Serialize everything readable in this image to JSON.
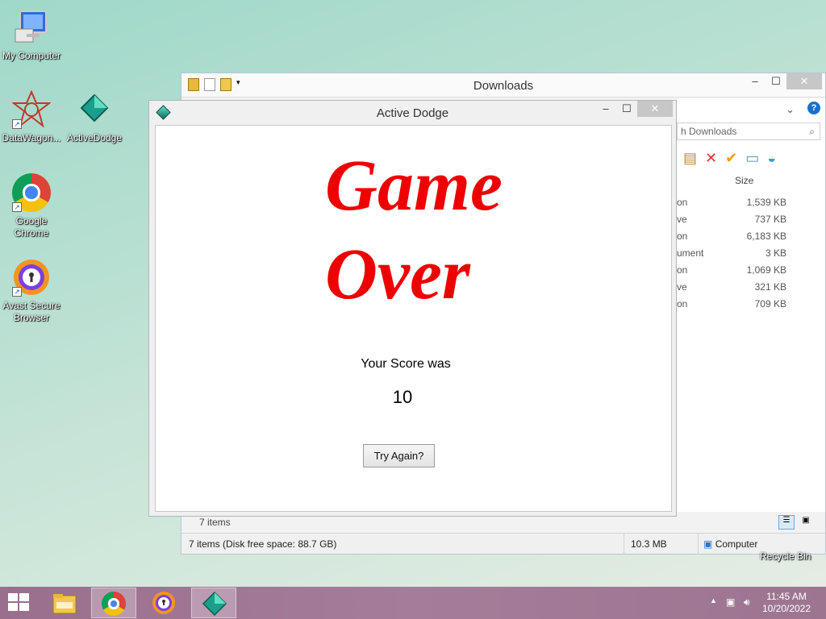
{
  "desktop": {
    "icons": [
      {
        "label": "My Computer"
      },
      {
        "label": "DataWagon..."
      },
      {
        "label": "ActiveDodge"
      },
      {
        "label": "Google Chrome"
      },
      {
        "label": "Avast Secure Browser"
      }
    ],
    "recycle_bin_label": "Recycle Bin"
  },
  "explorer": {
    "title": "Downloads",
    "search_placeholder": "h Downloads",
    "column_size": "Size",
    "rows": [
      {
        "type": "on",
        "size": "1,539 KB"
      },
      {
        "type": "ve",
        "size": "737 KB"
      },
      {
        "type": "on",
        "size": "6,183 KB"
      },
      {
        "type": "ument",
        "size": "3 KB"
      },
      {
        "type": "on",
        "size": "1,069 KB"
      },
      {
        "type": "ve",
        "size": "321 KB"
      },
      {
        "type": "on",
        "size": "709 KB"
      }
    ],
    "items_count": "7 items",
    "status": {
      "summary": "7 items (Disk free space: 88.7 GB)",
      "total_size": "10.3 MB",
      "location": "Computer"
    }
  },
  "game": {
    "title": "Active Dodge",
    "headline_line1": "Game",
    "headline_line2": "Over",
    "score_label": "Your Score was",
    "score_value": "10",
    "retry_label": "Try Again?"
  },
  "taskbar": {
    "time": "11:45 AM",
    "date": "10/20/2022"
  },
  "colors": {
    "game_over_text": "#ee0000",
    "taskbar": "#a07893"
  }
}
